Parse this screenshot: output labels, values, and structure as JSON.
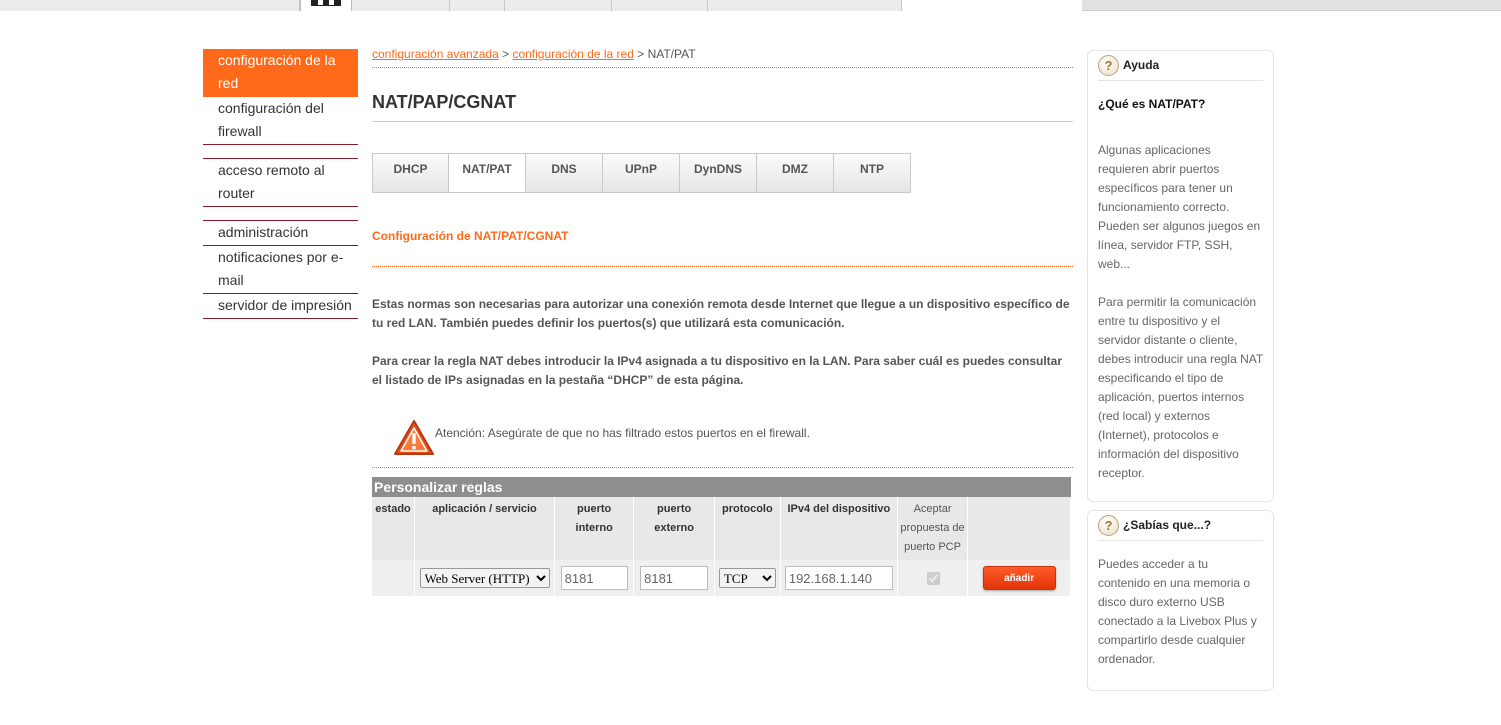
{
  "sidebar": {
    "items": [
      {
        "label": "configuración de la red"
      },
      {
        "label": "configuración del firewall"
      },
      {
        "label": "acceso remoto al router"
      },
      {
        "label": "administración"
      },
      {
        "label": "notificaciones por e-mail"
      },
      {
        "label": "servidor de impresión"
      }
    ]
  },
  "breadcrumb": {
    "link1": "configuración avanzada",
    "sep1": " > ",
    "link2": "configuración de la red",
    "sep2": " > ",
    "current": "NAT/PAT"
  },
  "page": {
    "title": "NAT/PAP/CGNAT",
    "section_title": "Configuración de NAT/PAT/CGNAT",
    "para1": "Estas normas son necesarias para autorizar una conexión remota desde Internet que llegue a un dispositivo específico de tu red LAN. También puedes definir los puertos(s) que utilizará esta comunicación.",
    "para2": "Para crear la regla NAT debes introducir la IPv4 asignada a tu dispositivo en la LAN. Para saber cuál es puedes consultar el listado de IPs asignadas en la pestaña “DHCP” de esta página.",
    "warning": "Atención: Asegúrate de que no has filtrado estos puertos en el firewall."
  },
  "tabs": [
    {
      "label": "DHCP"
    },
    {
      "label": "NAT/PAT"
    },
    {
      "label": "DNS"
    },
    {
      "label": "UPnP"
    },
    {
      "label": "DynDNS"
    },
    {
      "label": "DMZ"
    },
    {
      "label": "NTP"
    }
  ],
  "rules_table": {
    "caption": "Personalizar reglas",
    "headers": [
      "estado",
      "aplicación / servicio",
      "puerto interno",
      "puerto externo",
      "protocolo",
      "IPv4 del dispositivo",
      "Aceptar propuesta de puerto PCP",
      ""
    ],
    "row": {
      "application": "Web Server (HTTP)",
      "internal_port": "8181",
      "external_port": "8181",
      "protocol": "TCP",
      "ipv4": "192.168.1.140",
      "pcp_checked": true,
      "add_label": "añadir"
    }
  },
  "help_panel": {
    "title": "Ayuda",
    "subtitle": "¿Qué es NAT/PAT?",
    "p1": "Algunas aplicaciones requieren abrir puertos específicos para tener un funcionamiento correcto. Pueden ser algunos juegos en línea, servidor FTP, SSH, web...",
    "p2": "Para permitir la comunicación entre tu dispositivo y el servidor distante o cliente, debes introducir una regla NAT especificando el tipo de aplicación, puertos internos (red local) y externos (Internet), protocolos e información del dispositivo receptor."
  },
  "tips_panel": {
    "title": "¿Sabías que...?",
    "p1": "Puedes acceder a tu contenido en una memoria o disco duro externo USB conectado a la Livebox Plus y compartirlo desde cualquier ordenador."
  },
  "colors": {
    "accent": "#ff6a1a",
    "nav_divider": "#8b1a2a",
    "table_caption": "#8e8e8e"
  },
  "icons": [
    "logo-icon",
    "warning-icon",
    "help-question-icon",
    "tips-question-icon"
  ]
}
